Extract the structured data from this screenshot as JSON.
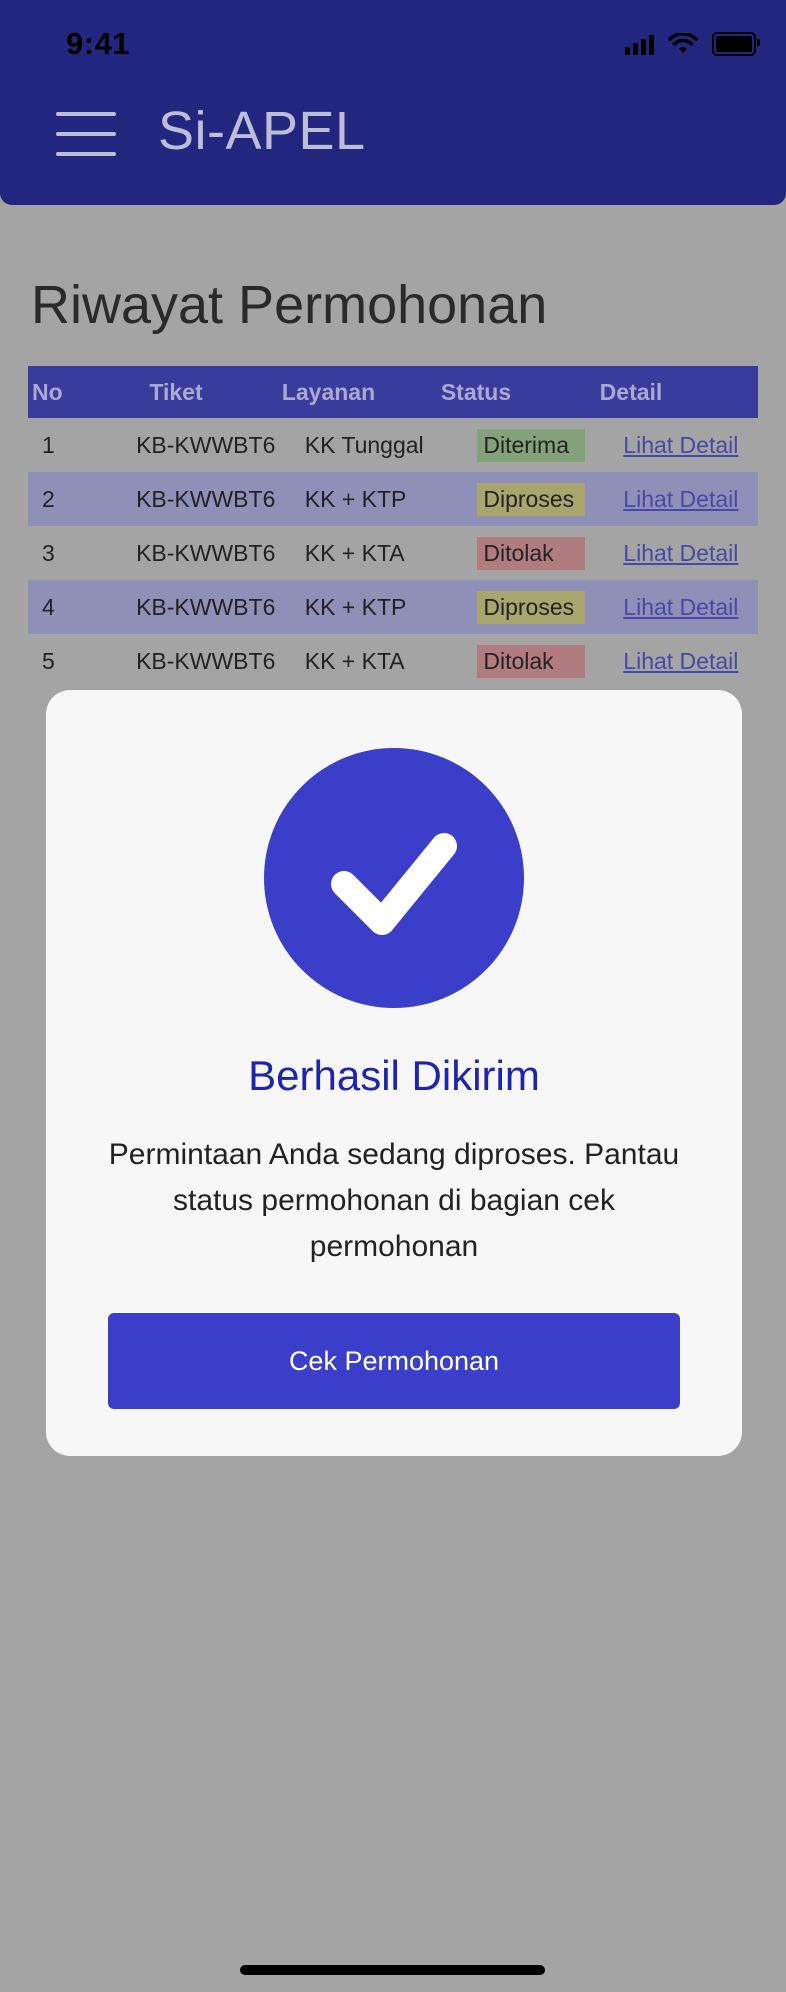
{
  "status_bar": {
    "time": "9:41"
  },
  "header": {
    "app_title": "Si-APEL"
  },
  "page": {
    "title": "Riwayat Permohonan"
  },
  "table": {
    "headers": {
      "no": "No",
      "tiket": "Tiket",
      "layanan": "Layanan",
      "status": "Status",
      "detail": "Detail"
    },
    "rows": [
      {
        "no": "1",
        "tiket": "KB-KWWBT6",
        "layanan": "KK Tunggal",
        "status": "Diterima",
        "detail": "Lihat Detail"
      },
      {
        "no": "2",
        "tiket": "KB-KWWBT6",
        "layanan": "KK + KTP",
        "status": "Diproses",
        "detail": "Lihat Detail"
      },
      {
        "no": "3",
        "tiket": "KB-KWWBT6",
        "layanan": "KK + KTA",
        "status": "Ditolak",
        "detail": "Lihat Detail"
      },
      {
        "no": "4",
        "tiket": "KB-KWWBT6",
        "layanan": "KK + KTP",
        "status": "Diproses",
        "detail": "Lihat Detail"
      },
      {
        "no": "5",
        "tiket": "KB-KWWBT6",
        "layanan": "KK + KTA",
        "status": "Ditolak",
        "detail": "Lihat Detail"
      }
    ]
  },
  "modal": {
    "icon": "check-circle-icon",
    "title": "Berhasil Dikirim",
    "message": "Permintaan Anda sedang diproses. Pantau status permohonan di bagian cek permohonan",
    "button_label": "Cek Permohonan"
  },
  "colors": {
    "header_bg": "#22267e",
    "accent": "#3a3ec9",
    "overlay_bg": "#a4a4a4",
    "modal_title": "#1d24b0"
  }
}
